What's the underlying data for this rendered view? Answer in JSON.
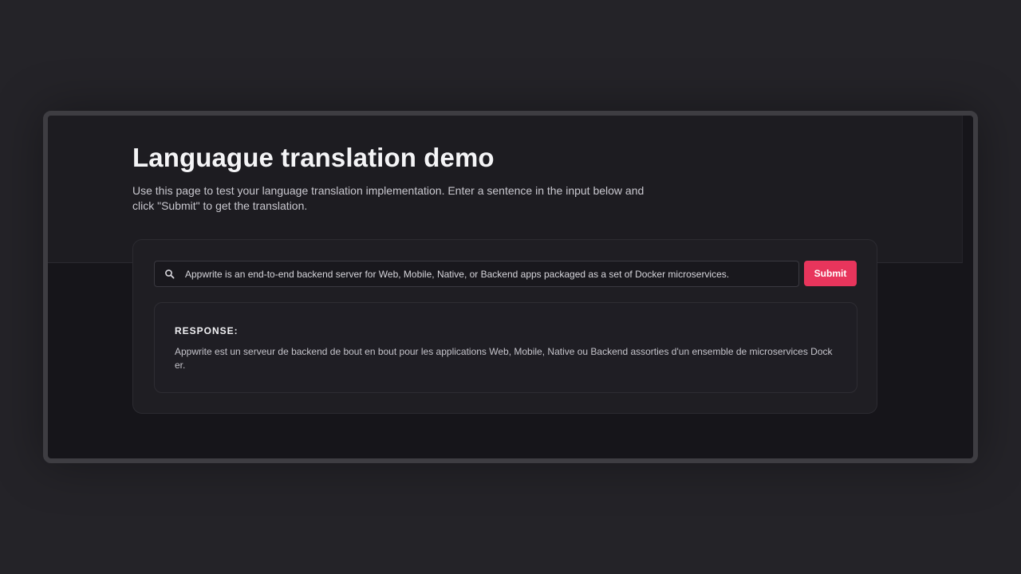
{
  "page": {
    "title": "Languague translation demo",
    "description": "Use this page to test your language translation implementation. Enter a sentence in the input below and click \"Submit\" to get the translation."
  },
  "search": {
    "icon": "search-icon",
    "value": "Appwrite is an end-to-end backend server for Web, Mobile, Native, or Backend apps packaged as a set of Docker microservices.",
    "placeholder": ""
  },
  "actions": {
    "submit_label": "Submit"
  },
  "response": {
    "label": "RESPONSE:",
    "text": "Appwrite est un serveur de backend de bout en bout pour les applications Web, Mobile, Native ou Backend assorties d'un ensemble de microservices Docker."
  },
  "colors": {
    "background": "#242328",
    "frame": "#3e3d42",
    "hero": "#1d1c21",
    "card": "#1f1e23",
    "accent": "#e8355c",
    "text_primary": "#f4f4f6",
    "text_secondary": "#c9c8cf"
  }
}
